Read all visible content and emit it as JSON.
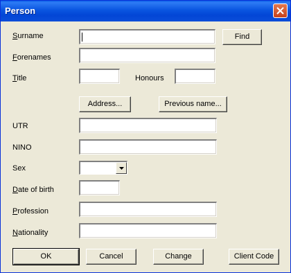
{
  "window": {
    "title": "Person"
  },
  "fields": {
    "surname": {
      "mn": "S",
      "rest": "urname",
      "value": ""
    },
    "forenames": {
      "mn": "F",
      "rest": "orenames",
      "value": ""
    },
    "title": {
      "mn": "T",
      "rest": "itle",
      "value": ""
    },
    "honours": {
      "label": "Honours",
      "value": ""
    },
    "utr": {
      "label": "UTR",
      "value": ""
    },
    "nino": {
      "label": "NINO",
      "value": ""
    },
    "sex": {
      "label": "Sex",
      "value": ""
    },
    "dob": {
      "mn": "D",
      "rest": "ate of birth",
      "value": ""
    },
    "profession": {
      "mn": "P",
      "rest": "rofession",
      "value": ""
    },
    "nationality": {
      "mn": "N",
      "rest": "ationality",
      "value": ""
    }
  },
  "buttons": {
    "find": "Find",
    "address": "Address...",
    "previous_name": "Previous name...",
    "ok": "OK",
    "cancel": "Cancel",
    "change": "Change",
    "client_code": "Client Code"
  },
  "colors": {
    "title_bar": "#0a55e0",
    "face": "#ece9d8",
    "close": "#c6421b"
  },
  "icons": {
    "close": "close-icon",
    "dropdown": "chevron-down-icon"
  }
}
